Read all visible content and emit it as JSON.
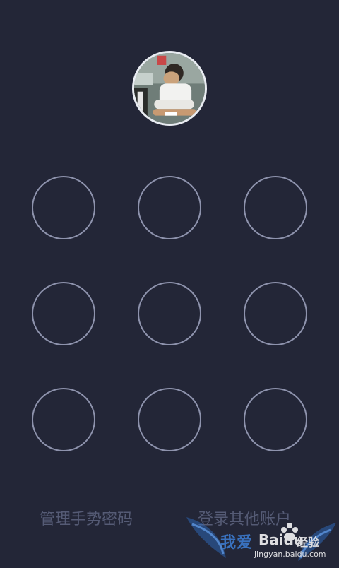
{
  "profile": {
    "avatar_icon": "user-avatar-photo"
  },
  "pattern": {
    "dot_count": 9,
    "dot_border_color": "#8e93ad",
    "background_color": "#232637"
  },
  "footer": {
    "manage_label": "管理手势密码",
    "switch_account_label": "登录其他账户"
  },
  "watermark": {
    "brand_left": "我爱",
    "brand_logo": "Baidu",
    "brand_right": "经验",
    "url": "jingyan.baidu.com"
  }
}
